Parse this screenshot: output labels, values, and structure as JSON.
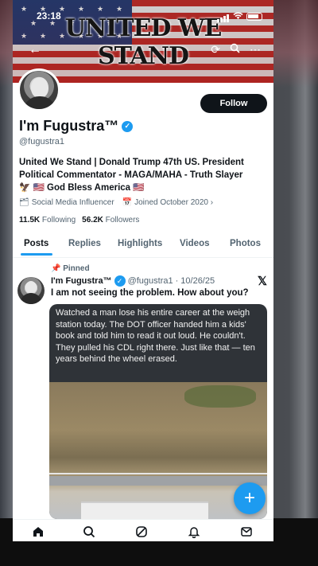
{
  "status_bar": {
    "time": "23:18"
  },
  "banner": {
    "title": "UNITED WE STAND"
  },
  "profile": {
    "display_name": "I'm Fugustra™",
    "handle": "@fugustra1",
    "follow_label": "Follow",
    "bio_line1": "United We Stand | Donald Trump 47th US. President",
    "bio_line2": "Political Commentator - MAGA/MAHA - Truth Slayer",
    "bio_line3": "🦅 🇺🇸 God Bless America 🇺🇸",
    "category": "Social Media Influencer",
    "joined": "Joined October 2020",
    "following_count": "11.5K",
    "following_label": "Following",
    "followers_count": "56.2K",
    "followers_label": "Followers"
  },
  "tabs": [
    "Posts",
    "Replies",
    "Highlights",
    "Videos",
    "Photos"
  ],
  "active_tab": "Posts",
  "post": {
    "pinned_label": "Pinned",
    "author_name": "I'm Fugustra™",
    "author_handle": "@fugustra1",
    "date": "10/26/25",
    "text": "I am not seeing the problem. How about you?",
    "media_caption": "Watched a man lose his entire career at the weigh station today. The DOT officer handed him a kids' book and told him to read it out loud. He couldn't. They pulled his CDL right there. Just like that — ten years behind the wheel erased."
  },
  "fab_label": "+",
  "colors": {
    "accent": "#1d9bf0",
    "text": "#0f1419",
    "muted": "#536471"
  },
  "bottom_nav_icons": [
    "home-icon",
    "search-icon",
    "grok-icon",
    "notifications-icon",
    "messages-icon"
  ]
}
